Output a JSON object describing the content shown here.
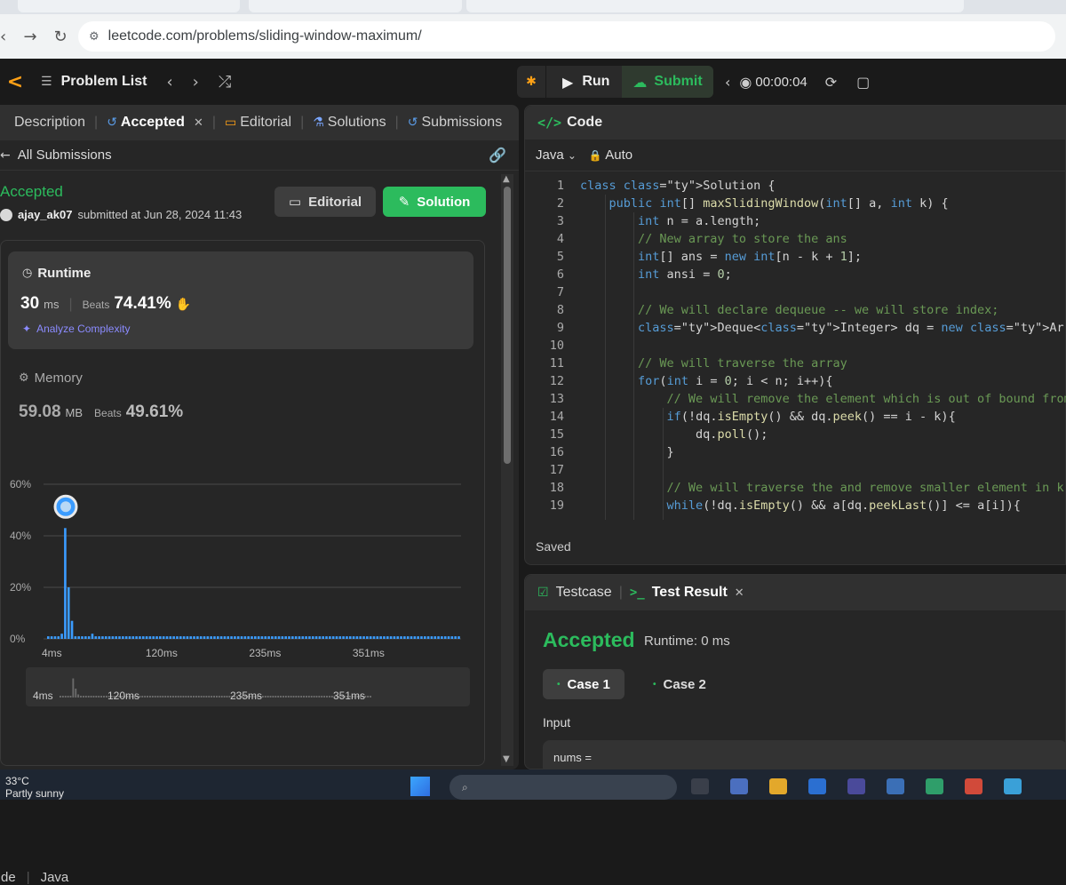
{
  "browser": {
    "url": "leetcode.com/problems/sliding-window-maximum/"
  },
  "topbar": {
    "problem_list": "Problem List",
    "run": "Run",
    "submit": "Submit",
    "timer": "00:00:04"
  },
  "left_tabs": {
    "description": "Description",
    "accepted": "Accepted",
    "editorial": "Editorial",
    "solutions": "Solutions",
    "submissions": "Submissions"
  },
  "subbar": {
    "all_submissions": "All Submissions"
  },
  "submission": {
    "status": "Accepted",
    "user": "ajay_ak07",
    "submitted_text": "submitted at Jun 28, 2024 11:43",
    "editorial_btn": "Editorial",
    "solution_btn": "Solution"
  },
  "runtime": {
    "title": "Runtime",
    "value": "30",
    "unit": "ms",
    "beats_label": "Beats",
    "beats": "74.41%",
    "analyze": "Analyze Complexity"
  },
  "memory": {
    "title": "Memory",
    "value": "59.08",
    "unit": "MB",
    "beats_label": "Beats",
    "beats": "49.61%"
  },
  "chart_data": {
    "type": "bar",
    "y_ticks": [
      "60%",
      "40%",
      "20%",
      "0%"
    ],
    "ylim": [
      0,
      60
    ],
    "x_ticks": [
      "4ms",
      "120ms",
      "235ms",
      "351ms"
    ],
    "nav_ticks": [
      "4ms",
      "120ms",
      "235ms",
      "351ms"
    ],
    "values": [
      1,
      1,
      1,
      1,
      2,
      43,
      20,
      7,
      1,
      1,
      1,
      1,
      1,
      2,
      1,
      1,
      1,
      1,
      1,
      1,
      1,
      1,
      1,
      1,
      1,
      1,
      1,
      1,
      1,
      1,
      1,
      1,
      1,
      1,
      1,
      1,
      1,
      1,
      1,
      1,
      1,
      1,
      1,
      1,
      1,
      1,
      1,
      1,
      1,
      1,
      1,
      1,
      1,
      1,
      1,
      1,
      1,
      1,
      1,
      1,
      1,
      1,
      1,
      1,
      1,
      1,
      1,
      1,
      1,
      1,
      1,
      1,
      1,
      1,
      1,
      1,
      1,
      1,
      1,
      1,
      1,
      1,
      1,
      1,
      1,
      1,
      1,
      1,
      1,
      1,
      1,
      1,
      1,
      1,
      1,
      1,
      1,
      1,
      1,
      1,
      1,
      1,
      1,
      1,
      1,
      1,
      1,
      1,
      1,
      1,
      1,
      1,
      1,
      1,
      1,
      1,
      1,
      1,
      1,
      1,
      1,
      1
    ],
    "highlight_index": 5,
    "bar_color": "#3b9cff"
  },
  "left_footer": {
    "a": "de",
    "b": "Java"
  },
  "code": {
    "header": "Code",
    "language": "Java",
    "mode": "Auto",
    "saved": "Saved",
    "lines": [
      "class Solution {",
      "    public int[] maxSlidingWindow(int[] a, int k) {",
      "        int n = a.length;",
      "        // New array to store the ans",
      "        int[] ans = new int[n - k + 1];",
      "        int ansi = 0;",
      "",
      "        // We will declare dequeue -- we will store index;",
      "        Deque<Integer> dq = new ArrayDeque<>();",
      "",
      "        // We will traverse the array",
      "        for(int i = 0; i < n; i++){",
      "            // We will remove the element which is out of bound from",
      "            if(!dq.isEmpty() && dq.peek() == i - k){",
      "                dq.poll();",
      "            }",
      "",
      "            // We will traverse the and remove smaller element in k",
      "            while(!dq.isEmpty() && a[dq.peekLast()] <= a[i]){"
    ]
  },
  "result": {
    "testcase_tab": "Testcase",
    "result_tab": "Test Result",
    "status": "Accepted",
    "runtime": "Runtime: 0 ms",
    "case1": "Case 1",
    "case2": "Case 2",
    "input_label": "Input",
    "input_value": "nums ="
  },
  "taskbar": {
    "temp": "33°C",
    "weather": "Partly sunny"
  },
  "colors": {
    "accent_green": "#2cbb5d",
    "accent_orange": "#ffa116"
  }
}
